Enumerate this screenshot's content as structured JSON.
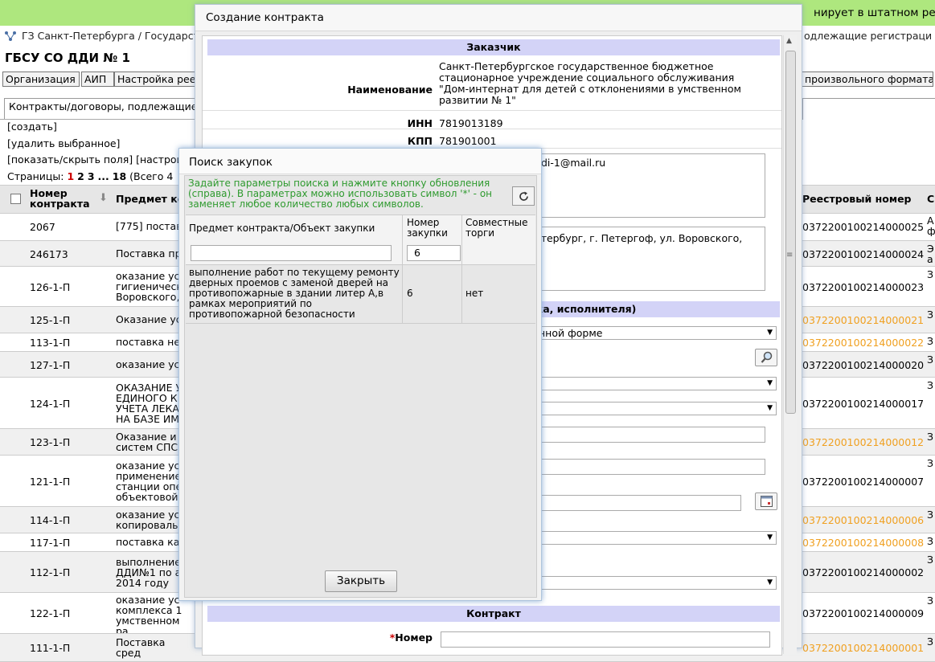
{
  "banner": {
    "text": "нирует в штатном реж"
  },
  "breadcrumb": {
    "left": "ГЗ Санкт-Петербурга / Государст",
    "right": "одлежащие регистраци"
  },
  "org": {
    "title": "ГБСУ СО ДДИ № 1"
  },
  "nav": {
    "org": "Организация",
    "aip": "АИП",
    "settings": "Настройка рее",
    "custom": "произвольного формата"
  },
  "tabs": {
    "contracts": "Контракты/договоры, подлежащие"
  },
  "actions": {
    "create": "[создать]",
    "delete": "[удалить выбранное]",
    "toggle": "[показать/скрыть поля] [настрои"
  },
  "pager": {
    "label": "Страницы:",
    "p1": "1",
    "p2": "2",
    "p3": "3",
    "dots": "...",
    "p18": "18",
    "total": "(Всего 4"
  },
  "table": {
    "col_num": "Номер контракта",
    "col_subject": "Предмет ко",
    "col_reg": "Реестровый номер",
    "col_last": "С",
    "rows": [
      {
        "num": "2067",
        "subj": "[775] постав",
        "reg": "0372200100214000025",
        "last": "А ф",
        "orange": false
      },
      {
        "num": "246173",
        "subj": "Поставка пр",
        "reg": "0372200100214000024",
        "last": "Э а",
        "orange": false
      },
      {
        "num": "126-1-П",
        "subj": "оказание ус гигиеническ Воровского,",
        "reg": "0372200100214000023",
        "last": "З",
        "orange": false
      },
      {
        "num": "125-1-П",
        "subj": "Оказание ус",
        "reg": "0372200100214000021",
        "last": "З",
        "orange": true
      },
      {
        "num": "113-1-П",
        "subj": "поставка не",
        "reg": "0372200100214000022",
        "last": "З",
        "orange": true
      },
      {
        "num": "127-1-П",
        "subj": "оказание ус",
        "reg": "0372200100214000020",
        "last": "З",
        "orange": false
      },
      {
        "num": "124-1-П",
        "subj": "ОКАЗАНИЕ У ЕДИНОГО К УЧЕТА ЛЕКА НА БАЗЕ ИМ",
        "reg": "0372200100214000017",
        "last": "З",
        "orange": false
      },
      {
        "num": "123-1-П",
        "subj": "Оказание и систем СПС",
        "reg": "0372200100214000012",
        "last": "З",
        "orange": true
      },
      {
        "num": "121-1-П",
        "subj": "оказание ус применение станции опе объектовой",
        "reg": "0372200100214000007",
        "last": "З",
        "orange": false
      },
      {
        "num": "114-1-П",
        "subj": "оказание ус копироваль",
        "reg": "0372200100214000006",
        "last": "З",
        "orange": true
      },
      {
        "num": "117-1-П",
        "subj": "поставка ка",
        "reg": "0372200100214000008",
        "last": "З",
        "orange": true
      },
      {
        "num": "112-1-П",
        "subj": "выполнение ДДИ№1 по а в 2014 году",
        "reg": "0372200100214000002",
        "last": "З",
        "orange": false
      },
      {
        "num": "122-1-П",
        "subj": "оказание ус комплекса 1 умственном ра",
        "reg": "0372200100214000009",
        "last": "З",
        "orange": false
      },
      {
        "num": "111-1-П",
        "subj": "Поставка сред",
        "reg": "0372200100214000001",
        "last": "З",
        "orange": true
      }
    ]
  },
  "contract_dialog": {
    "title": "Создание контракта",
    "customer_header": "Заказчик",
    "name_label": "Наименование",
    "name_value": "Санкт-Петербургское государственное бюджетное стационарное учреждение социального обслуживания \"Дом-интернат для детей с отклонениями в умственном развитии № 1\"",
    "inn_label": "ИНН",
    "inn_value": "7819013189",
    "kpp_label": "КПП",
    "kpp_value": "781901001",
    "email_value": "di-1@mail.ru",
    "address_value": "етербург, г. Петергоф, ул. Воровского,",
    "supplier_header": "ика, исполнителя)",
    "form_select": "нной форме",
    "contract_header": "Контракт",
    "number_label": "*Номер"
  },
  "search_dialog": {
    "title": "Поиск закупок",
    "hint": "Задайте параметры поиска и нажмите кнопку обновления (справа). В параметрах можно использовать символ '*' - он заменяет любое количество любых символов.",
    "col_subject": "Предмет контракта/Объект закупки",
    "col_number": "Номер закупки",
    "col_joint": "Совместные торги",
    "filter_subject": "",
    "filter_number": "6",
    "result": {
      "subject": "выполнение работ по текущему ремонту дверных проемов с заменой дверей на противопожарные в здании литер А,в рамках мероприятий по противопожарной безопасности",
      "number": "6",
      "joint": "нет"
    },
    "close": "Закрыть"
  }
}
